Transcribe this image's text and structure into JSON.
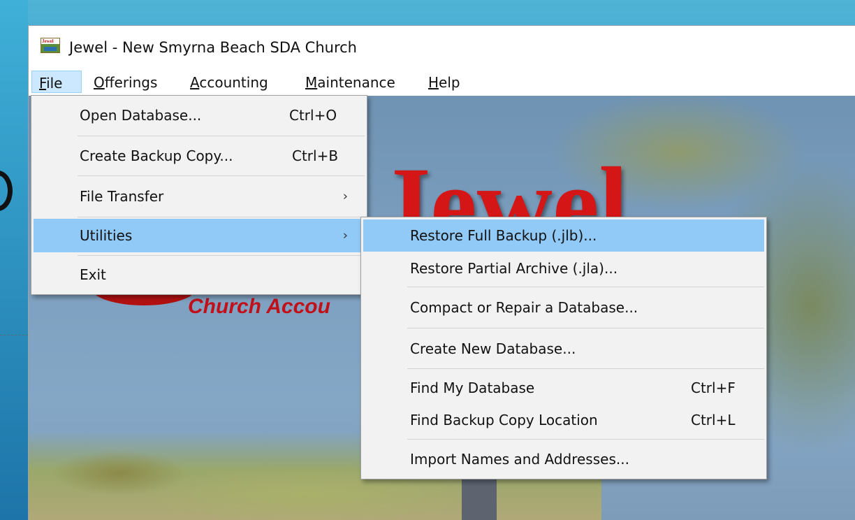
{
  "window": {
    "title": "Jewel - New Smyrna Beach SDA Church",
    "icon_text": "Jewel"
  },
  "menubar": {
    "items": [
      {
        "label_prefix": "F",
        "label_rest": "ile"
      },
      {
        "label_prefix": "O",
        "label_rest": "fferings"
      },
      {
        "label_prefix": "A",
        "label_rest": "ccounting"
      },
      {
        "label_prefix": "M",
        "label_rest": "aintenance"
      },
      {
        "label_prefix": "H",
        "label_rest": "elp"
      }
    ]
  },
  "file_menu": {
    "items": [
      {
        "label": "Open Database...",
        "shortcut": "Ctrl+O"
      },
      {
        "label": "Create Backup Copy...",
        "shortcut": "Ctrl+B"
      },
      {
        "label": "File Transfer",
        "arrow": "›"
      },
      {
        "label": "Utilities",
        "arrow": "›"
      },
      {
        "label": "Exit"
      }
    ]
  },
  "utilities_menu": {
    "items": [
      {
        "label": "Restore Full Backup (.jlb)..."
      },
      {
        "label": "Restore Partial Archive (.jla)..."
      },
      {
        "label": "Compact or Repair a Database..."
      },
      {
        "label": "Create New Database..."
      },
      {
        "label": "Find My Database",
        "shortcut": "Ctrl+F"
      },
      {
        "label": "Find Backup Copy Location",
        "shortcut": "Ctrl+L"
      },
      {
        "label": "Import Names and Addresses..."
      }
    ]
  },
  "background": {
    "logo_text": "Jewel",
    "logo_subtitle": "Church Accou"
  },
  "colors": {
    "highlight": "#91c9f7",
    "menu_bg": "#f2f2f2",
    "logo_red": "#d41616"
  }
}
